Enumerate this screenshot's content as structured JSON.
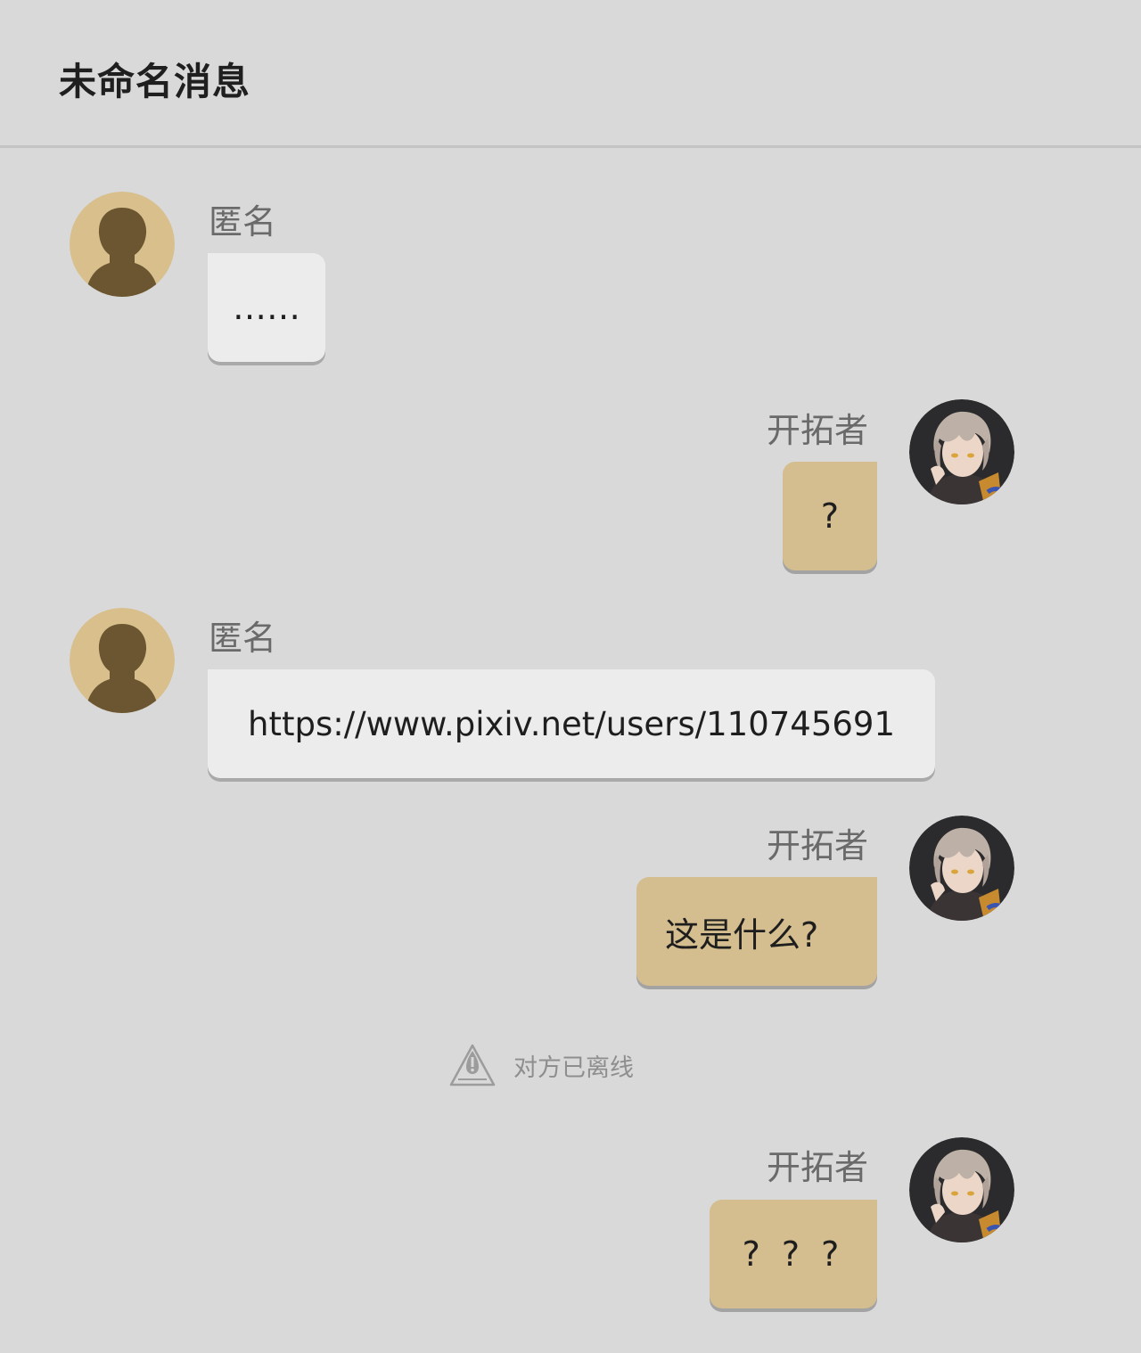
{
  "header": {
    "title": "未命名消息"
  },
  "messages": [
    {
      "side": "in",
      "sender": "匿名",
      "text": "……"
    },
    {
      "side": "out",
      "sender": "开拓者",
      "text": "?"
    },
    {
      "side": "in",
      "sender": "匿名",
      "text": "https://www.pixiv.net/users/110745691"
    },
    {
      "side": "out",
      "sender": "开拓者",
      "text": "这是什么?"
    },
    {
      "side": "out",
      "sender": "开拓者",
      "text": "? ? ?"
    }
  ],
  "notice": {
    "icon": "offline-warning-icon",
    "text": "对方已离线"
  },
  "colors": {
    "background": "#d9d9d9",
    "incoming_bubble": "#ececec",
    "outgoing_bubble": "#d4bd8e",
    "anonymous_avatar_bg": "#d8bf8c",
    "anonymous_avatar_silhouette": "#6b5631"
  }
}
